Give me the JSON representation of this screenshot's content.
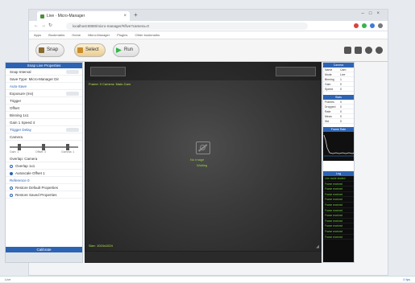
{
  "browser": {
    "tab_title": "Live · Micro-Manager",
    "url": "localhost:8080/micro-manager/#/live?camera=0",
    "bookmarks": [
      "Apps",
      "Bookmarks",
      "Home",
      "Micro-Manager",
      "Plugins",
      "Other bookmarks"
    ]
  },
  "toolbar": {
    "snap_label": "Snap",
    "select_label": "Select",
    "run_label": "Run"
  },
  "left_panel": {
    "title": "Snap Live Properties",
    "rows": [
      "Snap  Interval",
      "Save  Type: Micro-Manager Dir",
      "Auto-Save",
      "Exposure (ms)",
      "Trigger",
      "Offset",
      "Binning  1x1",
      "Gain  1  Speed  4",
      "Trigger Delay",
      "Overlap: Camera",
      "Camera",
      "Gain: 1",
      "Offset: 0",
      "Gamma: 1"
    ],
    "checks": [
      "Overlap  1x1",
      "Autoscale  Offset 1",
      "Reference 0",
      "Restore Default Properties",
      "Restore Saved Properties"
    ],
    "footer_label": "Calibrate"
  },
  "camera": {
    "top_caption": "Frame: 0   Camera: Main-Cam",
    "bottom_caption": "Size: 1024x1024",
    "center_label": "No Image",
    "center_sublabel": "Waiting"
  },
  "right_panel": {
    "title": "Camera",
    "props": [
      [
        "Name",
        "Cam"
      ],
      [
        "Mode",
        "Live"
      ],
      [
        "Binning",
        "1"
      ],
      [
        "Gain",
        "0"
      ],
      [
        "Speed",
        "0"
      ]
    ],
    "stats_title": "Stats",
    "stats": [
      [
        "Frames",
        "0"
      ],
      [
        "Dropped",
        "0"
      ],
      [
        "Rate",
        "0"
      ],
      [
        "Mean",
        "0"
      ],
      [
        "Std",
        "0"
      ]
    ],
    "graph_title": "Frame Rate",
    "log_title": "Log",
    "log_lines": [
      "Live mode started",
      "Frame received",
      "Frame received",
      "Frame received",
      "Frame received",
      "Frame received",
      "Frame received",
      "Frame received",
      "Frame received",
      "Frame received",
      "Frame received",
      "Frame received"
    ]
  },
  "status": {
    "left": "Live",
    "right": "0 fps"
  },
  "colors": {
    "accent": "#2d63b3",
    "run_green": "#35b54a",
    "caption_green": "#b4e24a"
  }
}
